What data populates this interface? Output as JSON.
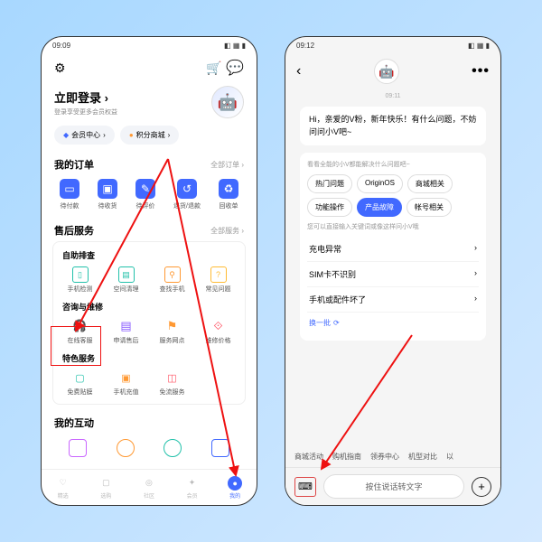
{
  "p1": {
    "status": {
      "time": "09:09"
    },
    "login": {
      "title": "立即登录",
      "sub": "登录享受更多会员权益"
    },
    "chips": {
      "member": "会员中心",
      "points": "积分商城"
    },
    "orders": {
      "title": "我的订单",
      "link": "全部订单",
      "items": [
        "待付款",
        "待收货",
        "待评价",
        "退货/退款",
        "回收单"
      ]
    },
    "after": {
      "title": "售后服务",
      "link": "全部服务",
      "self": {
        "title": "自助排查",
        "items": [
          "手机检测",
          "空间清理",
          "查找手机",
          "常见问题"
        ]
      },
      "consult": {
        "title": "咨询与维修",
        "items": [
          "在线客服",
          "申请售后",
          "服务网点",
          "维修价格"
        ]
      },
      "special": {
        "title": "特色服务",
        "items": [
          "免费贴膜",
          "手机充值",
          "免流服务"
        ]
      }
    },
    "interact": {
      "title": "我的互动"
    },
    "tabs": [
      "精选",
      "选购",
      "社区",
      "会员",
      "我的"
    ]
  },
  "p2": {
    "status": {
      "time": "09:12"
    },
    "time_center": "09:11",
    "greeting": "Hi，亲爱的V粉，新年快乐！有什么问题，不妨问问小V吧~",
    "sugg_title": "看看全能的小V都能解决什么问题吧~",
    "pills": [
      "热门问题",
      "OriginOS",
      "商城相关",
      "功能操作",
      "产品故障",
      "帐号相关"
    ],
    "sub": "您可以直接输入关键词或像这样问小V哦",
    "list": [
      "充电异常",
      "SIM卡不识别",
      "手机或配件坏了"
    ],
    "refresh": "换一批",
    "botchips": [
      "商城活动",
      "购机指南",
      "领券中心",
      "机型对比",
      "以"
    ],
    "voice": "按住说话转文字"
  }
}
